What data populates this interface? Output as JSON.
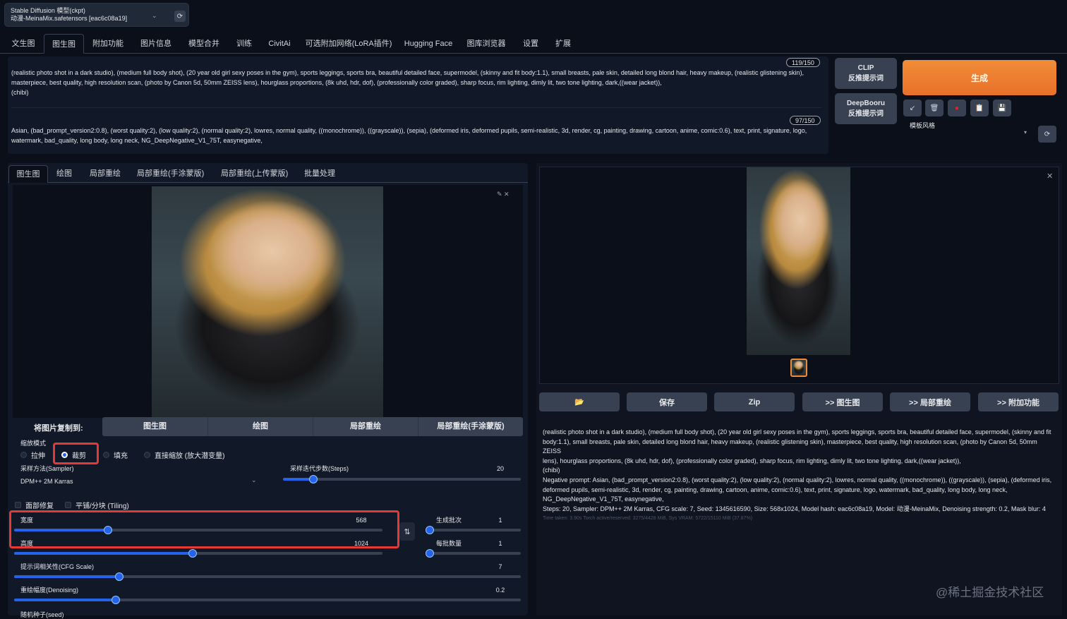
{
  "model": {
    "label": "Stable Diffusion 模型(ckpt)",
    "value": "动漫-MeinaMix.safetensors [eac6c08a19]"
  },
  "tabs": [
    "文生图",
    "图生图",
    "附加功能",
    "图片信息",
    "模型合并",
    "训练",
    "CivitAi",
    "可选附加网络(LoRA插件)",
    "Hugging Face",
    "图库浏览器",
    "设置",
    "扩展"
  ],
  "prompt": {
    "positive_line1": "(realistic photo shot in a dark studio), (medium full body shot), (20 year old girl sexy poses in the gym), sports leggings, sports bra, beautiful detailed face, supermodel, (skinny and fit body:1.1), small breasts, pale skin, detailed long blond hair, heavy makeup, (realistic glistening skin),",
    "positive_line2": "masterpiece, best quality, high resolution scan, (photo by Canon 5d, 50mm ZEISS lens), hourglass proportions, (8k uhd, hdr, dof), (professionally color graded), sharp focus, rim lighting, dimly lit, two tone lighting, dark,((wear jacket)),",
    "positive_line3": "(chibi)",
    "positive_counter": "119/150",
    "negative_line1": "Asian, (bad_prompt_version2:0.8), (worst quality:2), (low quality:2), (normal quality:2), lowres, normal quality, ((monochrome)), ((grayscale)), (sepia), (deformed iris, deformed pupils, semi-realistic, 3d, render, cg, painting, drawing, cartoon, anime, comic:0.6), text, print, signature, logo,",
    "negative_line2": "watermark, bad_quality, long body, long neck, NG_DeepNegative_V1_75T, easynegative,",
    "negative_counter": "97/150"
  },
  "side": {
    "clip_line1": "CLIP",
    "clip_line2": "反推提示词",
    "deepbooru_line1": "DeepBooru",
    "deepbooru_line2": "反推提示词",
    "generate": "生成",
    "style_label": "模板风格",
    "tools": [
      "↙",
      "🗑",
      "●",
      "📋",
      "💾"
    ]
  },
  "subtabs": [
    "图生图",
    "绘图",
    "局部重绘",
    "局部重绘(手涂蒙版)",
    "局部重绘(上传蒙版)",
    "批量处理"
  ],
  "copy": {
    "label": "将图片复制到:",
    "buttons": [
      "图生图",
      "绘图",
      "局部重绘",
      "局部重绘(手涂蒙版)"
    ]
  },
  "resize": {
    "label": "缩放模式",
    "options": [
      "拉伸",
      "裁剪",
      "填充",
      "直接缩放 (放大潜变量)"
    ],
    "selected": "裁剪"
  },
  "sampler": {
    "label": "采样方法(Sampler)",
    "value": "DPM++ 2M Karras"
  },
  "steps": {
    "label": "采样迭代步数(Steps)",
    "value": "20",
    "min": 1,
    "max": 150
  },
  "checks": {
    "face": "面部修复",
    "tiling": "平铺/分块 (Tiling)"
  },
  "width": {
    "label": "宽度",
    "value": "568",
    "min": 64,
    "max": 2048
  },
  "height": {
    "label": "高度",
    "value": "1024",
    "min": 64,
    "max": 2048
  },
  "batch_count": {
    "label": "生成批次",
    "value": "1",
    "min": 1,
    "max": 100
  },
  "batch_size": {
    "label": "每批数量",
    "value": "1",
    "min": 1,
    "max": 8
  },
  "cfg": {
    "label": "提示词相关性(CFG Scale)",
    "value": "7",
    "min": 1,
    "max": 30
  },
  "denoise": {
    "label": "重绘幅度(Denoising)",
    "value": "0.2",
    "min": 0,
    "max": 1
  },
  "seed_label": "随机种子(seed)",
  "output": {
    "buttons": [
      "📂",
      "保存",
      "Zip",
      ">> 图生图",
      ">> 局部重绘",
      ">> 附加功能"
    ],
    "info_l1": "(realistic photo shot in a dark studio), (medium full body shot), (20 year old girl sexy poses in the gym), sports leggings, sports bra, beautiful detailed face, supermodel, (skinny and fit",
    "info_l2": "body:1.1), small breasts, pale skin, detailed long blond hair, heavy makeup, (realistic glistening skin), masterpiece, best quality, high resolution scan, (photo by Canon 5d, 50mm ZEISS",
    "info_l3": "lens), hourglass proportions, (8k uhd, hdr, dof), (professionally color graded), sharp focus, rim lighting, dimly lit, two tone lighting, dark,((wear jacket)),",
    "info_l4": "(chibi)",
    "info_l5": "Negative prompt: Asian, (bad_prompt_version2:0.8), (worst quality:2), (low quality:2), (normal quality:2), lowres, normal quality, ((monochrome)), ((grayscale)), (sepia), (deformed iris,",
    "info_l6": "deformed pupils, semi-realistic, 3d, render, cg, painting, drawing, cartoon, anime, comic:0.6), text, print, signature, logo, watermark, bad_quality, long body, long neck,",
    "info_l7": "NG_DeepNegative_V1_75T, easynegative,",
    "info_l8": "Steps: 20, Sampler: DPM++ 2M Karras, CFG scale: 7, Seed: 1345616590, Size: 568x1024, Model hash: eac6c08a19, Model: 动漫-MeinaMix, Denoising strength: 0.2, Mask blur: 4",
    "info_l9": "Time taken: 3.90s  Torch active/reserved: 3275/4428 MiB, Sys VRAM: 5722/15110 MiB (37.87%)"
  },
  "watermark": "@稀土掘金技术社区"
}
